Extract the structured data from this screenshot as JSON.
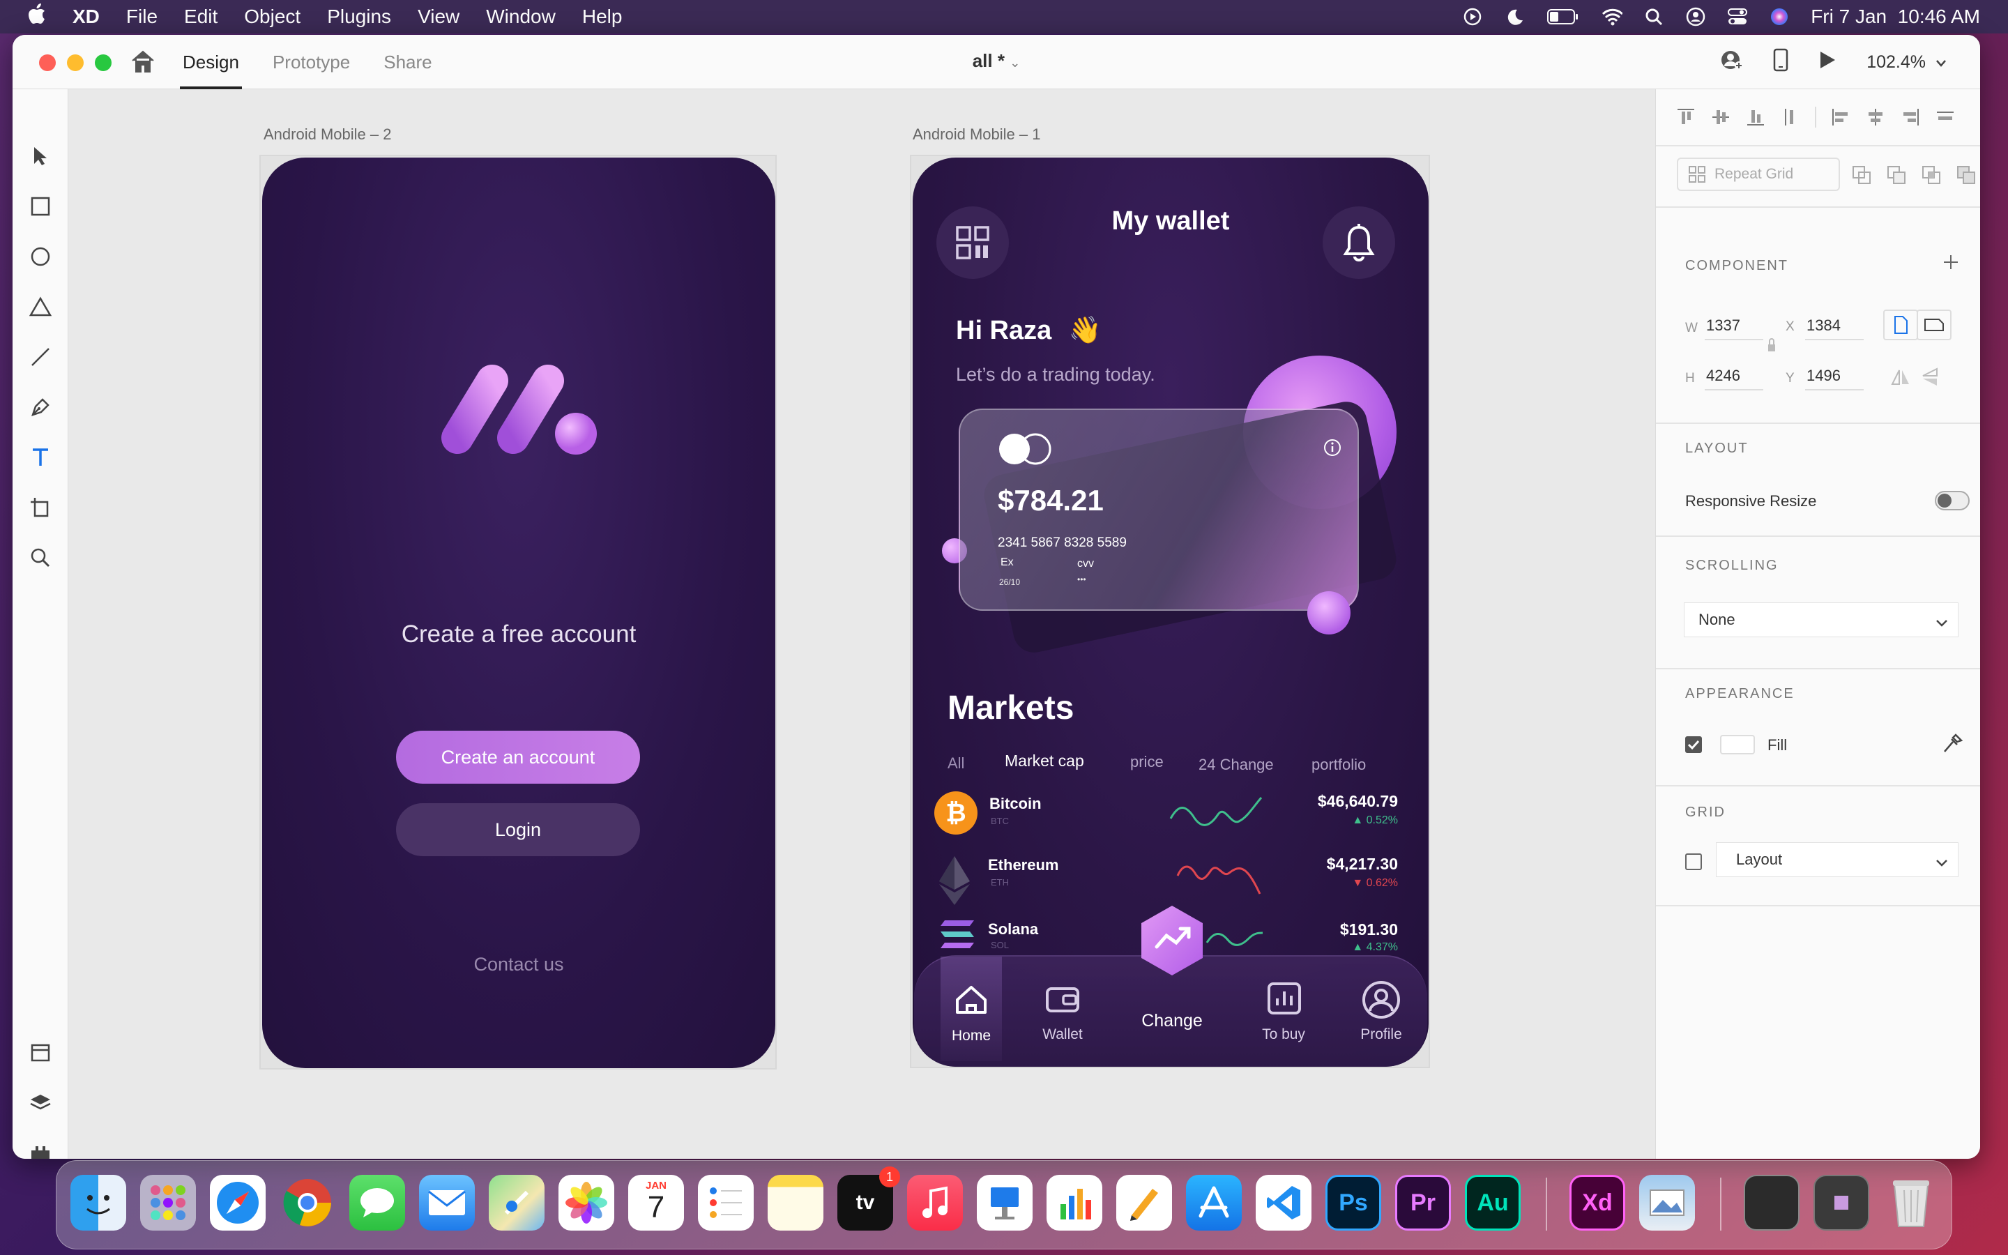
{
  "menubar": {
    "app_name": "XD",
    "menus": [
      "File",
      "Edit",
      "Object",
      "Plugins",
      "View",
      "Window",
      "Help"
    ],
    "clock": "Fri 7 Jan  10:46 AM"
  },
  "window": {
    "tabs": [
      "Design",
      "Prototype",
      "Share"
    ],
    "doc_title": "all *",
    "zoom": "102.4%"
  },
  "canvas": {
    "artboard_2_label": "Android Mobile – 2",
    "artboard_1_label": "Android Mobile – 1"
  },
  "screen_signup": {
    "heading": "Create a free account",
    "create_button": "Create an account",
    "login_button": "Login",
    "contact": "Contact us"
  },
  "screen_wallet": {
    "title": "My wallet",
    "greeting": "Hi Raza",
    "wave_emoji": "👋",
    "subtitle": "Let’s do a trading today.",
    "card": {
      "balance": "$784.21",
      "number": "2341 5867 8328 5589",
      "ex_label": "Ex",
      "ex_value": "26/10",
      "cvv_label": "cvv",
      "cvv_value": "•••"
    },
    "markets_title": "Markets",
    "filters": [
      "All",
      "Market cap",
      "price",
      "24 Change",
      "portfolio"
    ],
    "coins": [
      {
        "name": "Bitcoin",
        "symbol": "BTC",
        "price": "$46,640.79",
        "change": "0.52%",
        "direction": "up"
      },
      {
        "name": "Ethereum",
        "symbol": "ETH",
        "price": "$4,217.30",
        "change": "0.62%",
        "direction": "down"
      },
      {
        "name": "Solana",
        "symbol": "SOL",
        "price": "$191.30",
        "change": "4.37%",
        "direction": "up"
      }
    ],
    "nav": [
      "Home",
      "Wallet",
      "Change",
      "To buy",
      "Profile"
    ]
  },
  "right_panel": {
    "repeat_grid": "Repeat Grid",
    "component_title": "COMPONENT",
    "w_label": "W",
    "w_value": "1337",
    "x_label": "X",
    "x_value": "1384",
    "h_label": "H",
    "h_value": "4246",
    "y_label": "Y",
    "y_value": "1496",
    "layout_title": "LAYOUT",
    "responsive_resize": "Responsive Resize",
    "scrolling_title": "SCROLLING",
    "scrolling_value": "None",
    "appearance_title": "APPEARANCE",
    "fill_label": "Fill",
    "grid_title": "GRID",
    "grid_value": "Layout"
  },
  "dock": {
    "calendar_month": "JAN",
    "calendar_day": "7",
    "tv_badge": "1",
    "ps": "Ps",
    "pr": "Pr",
    "au": "Au",
    "xd": "Xd"
  },
  "colors": {
    "accent_purple": "#c46ee8",
    "phone_bg": "#2c1746",
    "up_green": "#3fbf8c",
    "down_red": "#e0464f"
  }
}
